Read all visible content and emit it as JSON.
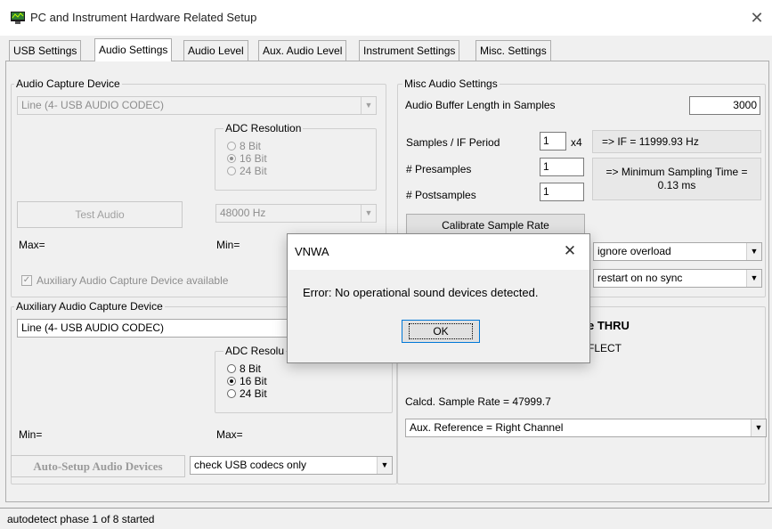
{
  "window": {
    "title": "PC and Instrument Hardware Related Setup",
    "close_glyph": "✕"
  },
  "tabs": [
    {
      "label": "USB Settings",
      "active": false
    },
    {
      "label": "Audio Settings",
      "active": true
    },
    {
      "label": "Audio Level",
      "active": false
    },
    {
      "label": "Aux. Audio Level",
      "active": false
    },
    {
      "label": "Instrument Settings",
      "active": false
    },
    {
      "label": "Misc. Settings",
      "active": false
    }
  ],
  "audio_capture": {
    "group_title": "Audio Capture Device",
    "device": "Line (4- USB AUDIO  CODEC)",
    "adc_title": "ADC Resolution",
    "adc_options": [
      "8 Bit",
      "16 Bit",
      "24 Bit"
    ],
    "adc_selected": "16 Bit",
    "test_button": "Test Audio",
    "rate": "48000 Hz",
    "max_label": "Max=",
    "min_label": "Min=",
    "aux_checkbox": "Auxiliary Audio Capture Device available",
    "aux_checked": true
  },
  "aux_capture": {
    "group_title": "Auxiliary Audio Capture Device",
    "device": "Line (4- USB AUDIO  CODEC)",
    "adc_title": "ADC Resolu",
    "adc_options": [
      "8 Bit",
      "16 Bit",
      "24 Bit"
    ],
    "adc_selected": "16 Bit",
    "min_label": "Min=",
    "max_label": "Max="
  },
  "misc": {
    "group_title": "Misc Audio Settings",
    "buffer_label": "Audio Buffer Length in Samples",
    "buffer_value": "3000",
    "samples_if_label": "Samples / IF Period",
    "samples_if_value": "1",
    "x4": "x4",
    "if_readout": "=> IF =  11999.93 Hz",
    "presamples_label": "# Presamples",
    "presamples_value": "1",
    "postsamples_label": "# Postsamples",
    "postsamples_value": "1",
    "min_sampling_line1": "=> Minimum Sampling Time =",
    "min_sampling_line2": "0.13 ms",
    "calibrate_button": "Calibrate Sample Rate",
    "overload_combo": "ignore overload",
    "sync_combo": "restart on no sync",
    "thru_fragment": "e THRU",
    "reflect_fragment": "FLECT",
    "calcd_rate": "Calcd. Sample Rate = 47999.7",
    "aux_reference": "Aux. Reference = Right Channel"
  },
  "bottom": {
    "auto_setup_button": "Auto-Setup Audio Devices",
    "codec_combo": "check USB codecs only"
  },
  "dialog": {
    "title": "VNWA",
    "close_glyph": "✕",
    "message": "Error: No operational sound devices detected.",
    "ok_button": "OK"
  },
  "status": {
    "text": "autodetect phase 1 of 8 started"
  },
  "icons": {
    "combo_arrow": "▼",
    "check_mark": "✓"
  },
  "colors": {
    "disabled_text": "#8d8d8d",
    "window_bg": "#f0f0f0",
    "focus_border": "#0078d7"
  }
}
